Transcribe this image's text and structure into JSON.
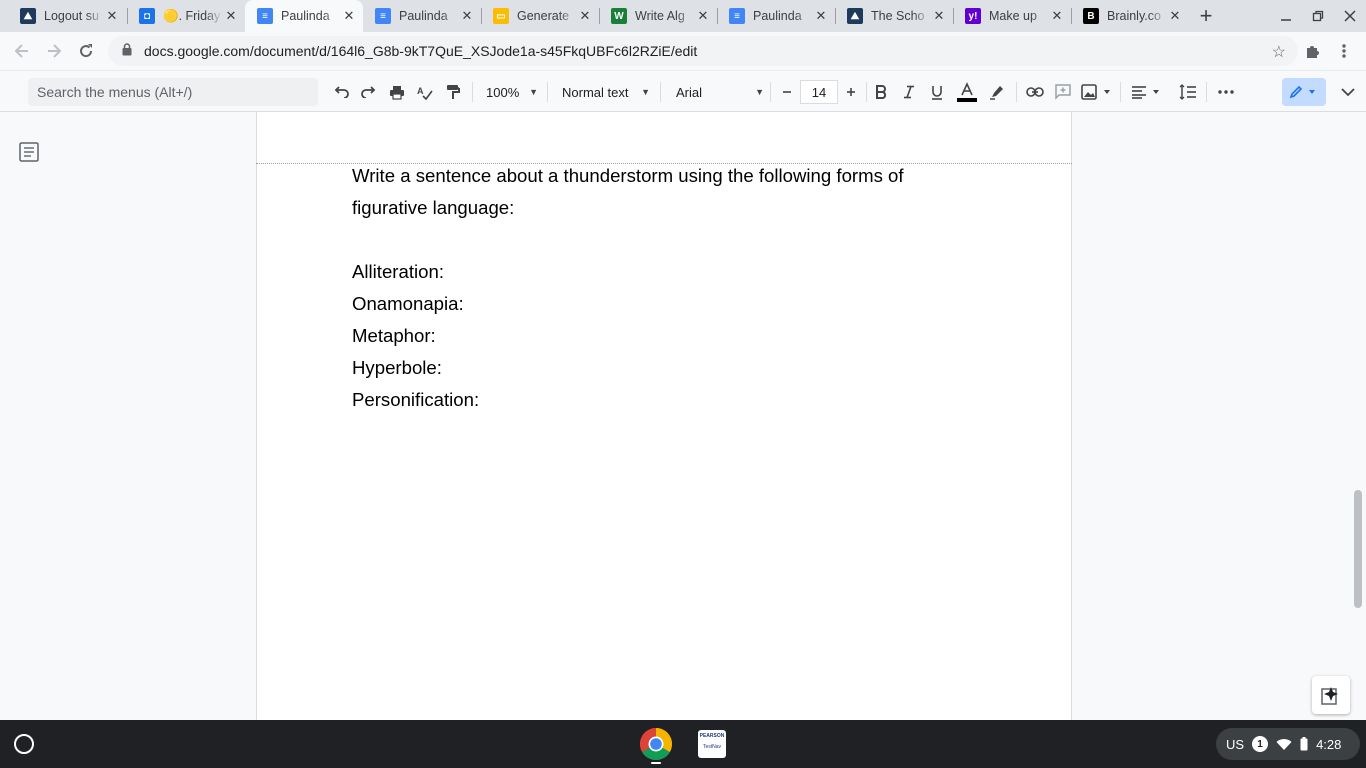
{
  "browser": {
    "tabs": [
      {
        "title": "Logout su",
        "icon": "schoology-icon",
        "color": "#1e3b5c"
      },
      {
        "title": "🟡. Friday",
        "icon": "contacts-icon",
        "color": "#1a73e8"
      },
      {
        "title": "Paulinda",
        "icon": "docs-icon",
        "color": "#4285f4",
        "active": true
      },
      {
        "title": "Paulinda",
        "icon": "docs-icon",
        "color": "#4285f4"
      },
      {
        "title": "Generate",
        "icon": "slides-icon",
        "color": "#fbbc04"
      },
      {
        "title": "Write Alg",
        "icon": "writer-icon",
        "color": "#188038"
      },
      {
        "title": "Paulinda",
        "icon": "docs-icon",
        "color": "#4285f4"
      },
      {
        "title": "The Scho",
        "icon": "schoology-icon",
        "color": "#1e3b5c"
      },
      {
        "title": "Make up",
        "icon": "yahoo-icon",
        "color": "#6001d2"
      },
      {
        "title": "Brainly.co",
        "icon": "brainly-icon",
        "color": "#000000"
      }
    ],
    "url": "docs.google.com/document/d/164l6_G8b-9kT7QuE_XSJode1a-s45FkqUBFc6l2RZiE/edit"
  },
  "toolbar": {
    "search_placeholder": "Search the menus (Alt+/)",
    "zoom": "100%",
    "style": "Normal text",
    "font": "Arial",
    "font_size": "14"
  },
  "document": {
    "lines": [
      "Write a sentence about a thunderstorm using the following forms of",
      "figurative language:",
      "",
      "Alliteration:",
      "Onamonapia:",
      "Metaphor:",
      "Hyperbole:",
      "Personification:"
    ]
  },
  "shelf": {
    "pearson_label": "PEARSON",
    "testnav_label": "TestNav",
    "locale": "US",
    "notification_count": "1",
    "time": "4:28"
  }
}
